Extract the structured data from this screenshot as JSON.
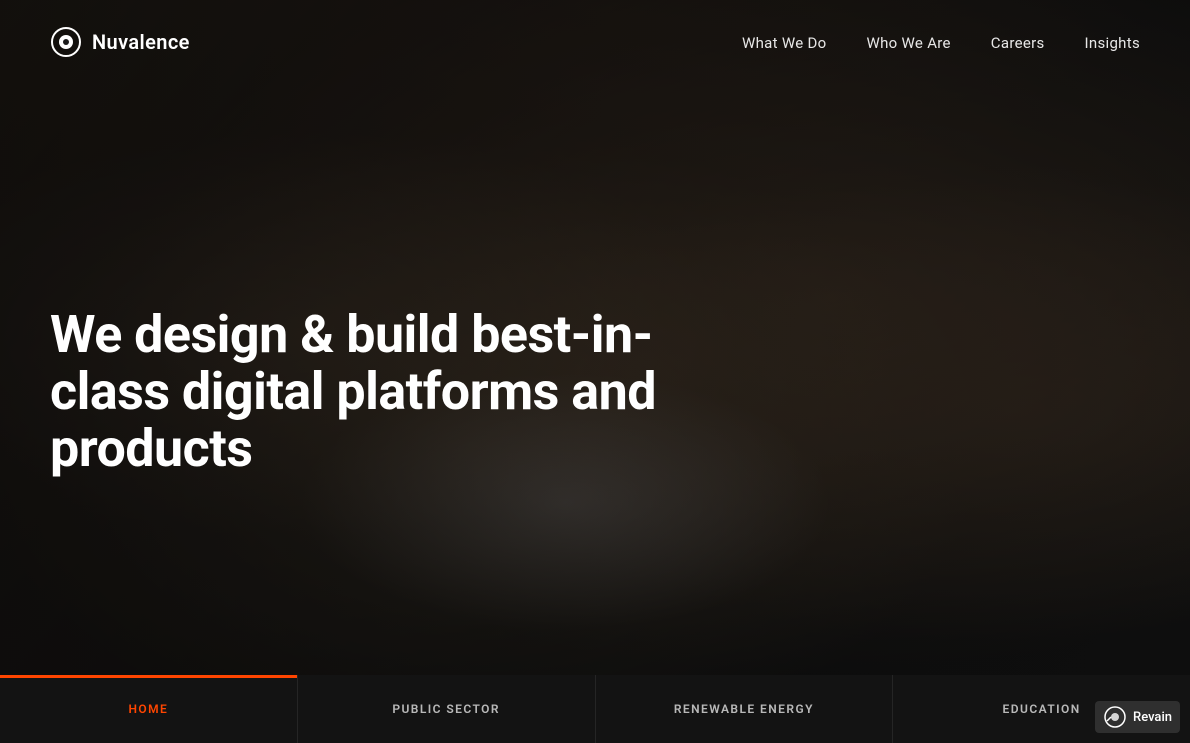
{
  "brand": {
    "logo_text": "Nuvalence",
    "logo_icon": "circle-icon"
  },
  "navbar": {
    "links": [
      {
        "id": "what-we-do",
        "label": "What We Do",
        "href": "#"
      },
      {
        "id": "who-we-are",
        "label": "Who We Are",
        "href": "#"
      },
      {
        "id": "careers",
        "label": "Careers",
        "href": "#"
      },
      {
        "id": "insights",
        "label": "Insights",
        "href": "#"
      }
    ]
  },
  "hero": {
    "headline": "We design & build best-in-class digital platforms and products"
  },
  "bottom_tabs": [
    {
      "id": "home",
      "label": "HOME",
      "active": true
    },
    {
      "id": "public-sector",
      "label": "PUBLIC SECTOR",
      "active": false
    },
    {
      "id": "renewable-energy",
      "label": "RENEWABLE ENERGY",
      "active": false
    },
    {
      "id": "education",
      "label": "EDUCATION",
      "active": false
    }
  ],
  "revain": {
    "text": "Revain"
  },
  "colors": {
    "accent": "#ff4500",
    "background": "#111111",
    "text_white": "#ffffff"
  }
}
